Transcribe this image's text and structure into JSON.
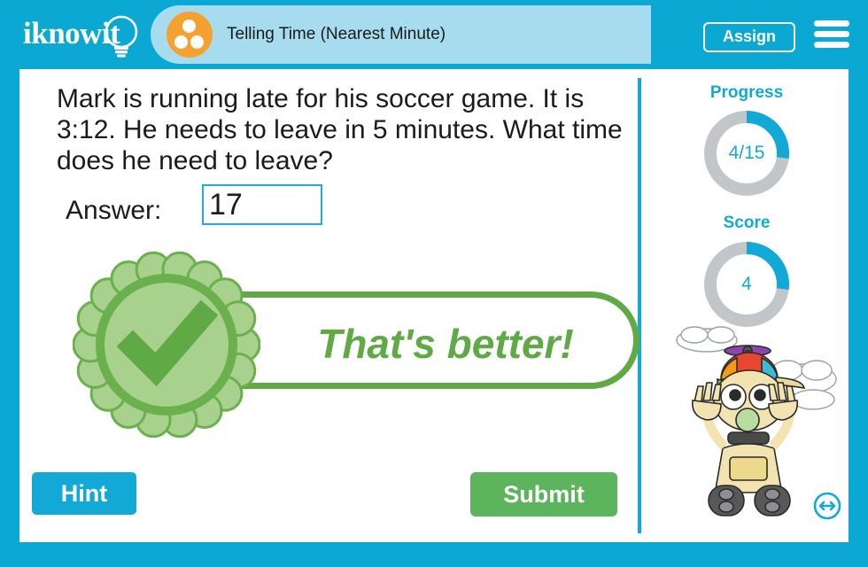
{
  "header": {
    "logo_text": "iknowit",
    "logo_icon": "lightbulb-icon",
    "lesson_icon": "three-dots-circle-icon",
    "lesson_title": "Telling Time (Nearest Minute)",
    "assign_label": "Assign",
    "menu_icon": "hamburger-menu-icon"
  },
  "question": {
    "text": "Mark is running late for his soccer game. It is 3:12. He needs to leave in 5 minutes. What time does he need to leave?"
  },
  "answer": {
    "label": "Answer:",
    "value": "17",
    "placeholder": ""
  },
  "feedback": {
    "message": "That's better!",
    "badge_icon": "green-check-rosette-icon",
    "accent_color": "#5faa45"
  },
  "sidebar": {
    "progress_label": "Progress",
    "progress_value": "4/15",
    "progress_completed": 4,
    "progress_total": 15,
    "progress_percent": 27,
    "score_label": "Score",
    "score_value": "4",
    "score_percent": 27,
    "ring_color": "#12a9d6",
    "ring_track_color": "#c2c6c8",
    "mascot_icon": "robot-mascot-icon"
  },
  "footer": {
    "hint_label": "Hint",
    "hint_color": "#12a9d6",
    "submit_label": "Submit",
    "submit_color": "#5cb55c",
    "resize_icon": "resize-horizontal-icon"
  },
  "theme": {
    "frame_color": "#0aa8d2",
    "title_pill_color": "#a6dced",
    "lesson_icon_color": "#f5a131"
  }
}
